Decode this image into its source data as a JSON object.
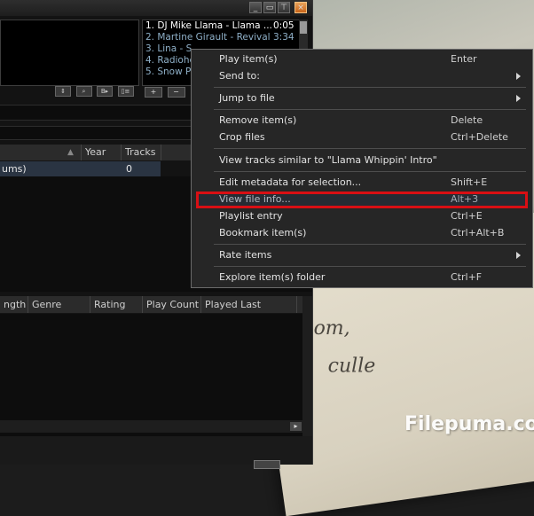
{
  "titlebar": {
    "buttons": [
      "_",
      "▭",
      "⊤",
      "×"
    ]
  },
  "mini_playlist": {
    "items": [
      {
        "title": "1. DJ Mike Llama - Llama ...",
        "time": "0:05",
        "active": true
      },
      {
        "title": "2. Martine Girault - Revival",
        "time": "3:34",
        "active": false
      },
      {
        "title": "3. Lina - S",
        "time": "",
        "active": false
      },
      {
        "title": "4. Radiohe",
        "time": "",
        "active": false
      },
      {
        "title": "5. Snow P",
        "time": "",
        "active": false
      }
    ],
    "buttons": [
      "+",
      "−"
    ]
  },
  "player_controls": [
    "⇕",
    "⌕",
    "B▸",
    "▯≡"
  ],
  "library": {
    "columns": {
      "year": "Year",
      "tracks": "Tracks"
    },
    "row": {
      "name": "ums)",
      "tracks": "0"
    }
  },
  "tracks_table": {
    "columns": [
      "ngth",
      "Genre",
      "Rating",
      "Play Count",
      "Played Last"
    ]
  },
  "context_menu": {
    "items": [
      {
        "label": "Play item(s)",
        "shortcut": "Enter"
      },
      {
        "label": "Send to:",
        "shortcut": ""
      },
      {
        "label": "Jump to file",
        "shortcut": ""
      },
      {
        "label": "Remove item(s)",
        "shortcut": "Delete"
      },
      {
        "label": "Crop files",
        "shortcut": "Ctrl+Delete"
      },
      {
        "label": "View tracks similar to \"Llama Whippin' Intro\"",
        "shortcut": ""
      },
      {
        "label": "Edit metadata for selection...",
        "shortcut": "Shift+E"
      },
      {
        "label": "View file info...",
        "shortcut": "Alt+3"
      },
      {
        "label": "Playlist entry",
        "shortcut": "Ctrl+E"
      },
      {
        "label": "Bookmark item(s)",
        "shortcut": "Ctrl+Alt+B"
      },
      {
        "label": "Rate items",
        "shortcut": ""
      },
      {
        "label": "Explore item(s) folder",
        "shortcut": "Ctrl+F"
      }
    ],
    "highlight_color": "#d80f14"
  },
  "background": {
    "book_words": [
      "om,",
      "culle"
    ]
  },
  "watermark": "Filepuma.com"
}
